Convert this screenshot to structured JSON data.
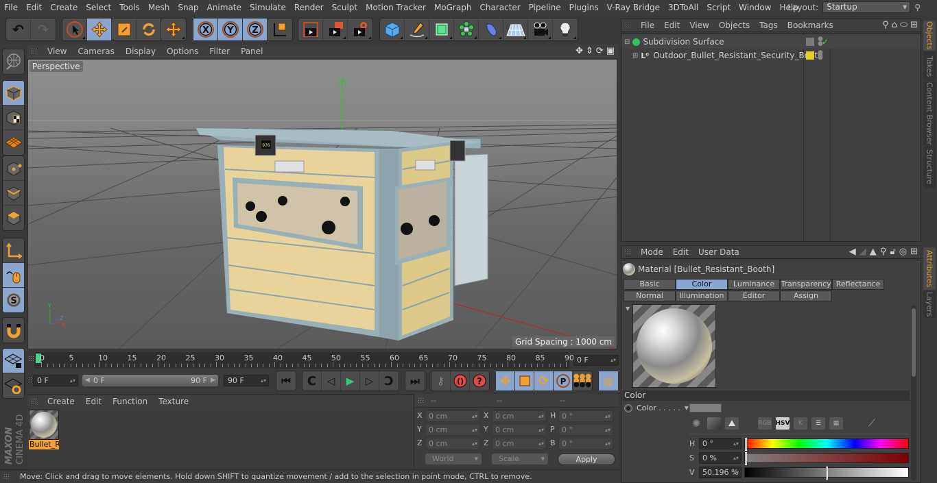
{
  "menubar": {
    "items": [
      "File",
      "Edit",
      "Create",
      "Select",
      "Tools",
      "Mesh",
      "Snap",
      "Animate",
      "Simulate",
      "Render",
      "Sculpt",
      "Motion Tracker",
      "MoGraph",
      "Character",
      "Pipeline",
      "Plugins",
      "V-Ray Bridge",
      "3DToAll",
      "Script",
      "Window",
      "Help"
    ],
    "layout_label": "Layout:",
    "layout_value": "Startup"
  },
  "toolbar": {
    "groups": [
      [
        "undo-icon",
        "redo-icon"
      ],
      [
        "live-selection-icon",
        "move-icon",
        "scale-icon",
        "rotate-icon"
      ],
      [
        "move-recent-icon"
      ],
      [
        "x-axis-lock-icon",
        "y-axis-lock-icon",
        "z-axis-lock-icon",
        "world-coordinates-icon"
      ],
      [
        "render-view-icon",
        "render-to-picture-viewer-icon",
        "render-settings-icon"
      ],
      [
        "cube-icon",
        "pen-icon",
        "subdivision-icon",
        "cloner-icon",
        "deformer-icon",
        "floor-icon",
        "camera-icon",
        "light-icon"
      ]
    ],
    "active": [
      "move-icon",
      "x-axis-lock-icon",
      "y-axis-lock-icon",
      "z-axis-lock-icon"
    ]
  },
  "left_tools": [
    "make-editable-icon",
    "model-mode-icon",
    "texture-mode-icon",
    "workplane-icon",
    "points-mode-icon",
    "edges-mode-icon",
    "polygons-mode-icon",
    "axis-mode-icon",
    "tweak-mode-icon",
    "snap-icon",
    "magnet-icon",
    "lock-workplane-icon",
    "planar-workplane-icon"
  ],
  "viewport": {
    "menu": [
      "View",
      "Cameras",
      "Display",
      "Options",
      "Filter",
      "Panel"
    ],
    "camera_label": "Perspective",
    "grid_spacing": "Grid Spacing : 1000 cm",
    "axis_labels": {
      "y": "Y",
      "z": "Z",
      "x": "X"
    }
  },
  "timeline": {
    "ticks": [
      "0",
      "5",
      "10",
      "15",
      "20",
      "25",
      "30",
      "35",
      "40",
      "45",
      "50",
      "55",
      "60",
      "65",
      "70",
      "75",
      "80",
      "85",
      "90"
    ],
    "current_frame": "0 F",
    "start_field": "0 F",
    "range_start": "0 F",
    "range_end": "90 F",
    "end_field": "90 F"
  },
  "material_manager": {
    "menu": [
      "Create",
      "Edit",
      "Function",
      "Texture"
    ],
    "materials": [
      {
        "label": "Bullet_R",
        "selected": true
      }
    ]
  },
  "coordinates": {
    "headers": [
      "--",
      "--",
      "--"
    ],
    "rows": [
      {
        "l1": "X",
        "v1": "0 cm",
        "l2": "X",
        "v2": "0 cm",
        "l3": "H",
        "v3": "0 °"
      },
      {
        "l1": "Y",
        "v1": "0 cm",
        "l2": "Y",
        "v2": "0 cm",
        "l3": "P",
        "v3": "0 °"
      },
      {
        "l1": "Z",
        "v1": "0 cm",
        "l2": "Z",
        "v2": "0 cm",
        "l3": "B",
        "v3": "0 °"
      }
    ],
    "space": "World",
    "mode": "Scale",
    "apply": "Apply"
  },
  "status": "Move: Click and drag to move elements. Hold down SHIFT to quantize movement / add to the selection in point mode, CTRL to remove.",
  "logo": {
    "brand": "MAXON",
    "product": "CINEMA 4D"
  },
  "object_manager": {
    "menu": [
      "File",
      "Edit",
      "View",
      "Objects",
      "Tags",
      "Bookmarks"
    ],
    "objects": [
      {
        "name": "Subdivision Surface",
        "tag_color": "#7a7a7a",
        "enabled": "✓"
      },
      {
        "name": "Outdoor_Bullet_Resistant_Security_Booth",
        "tag_color": "#e0d020"
      }
    ]
  },
  "right_tabs_top": [
    "Objects",
    "Takes",
    "Content Browser",
    "Structure"
  ],
  "right_tabs_bottom": [
    "Attributes",
    "Layers"
  ],
  "attributes": {
    "menu": [
      "Mode",
      "Edit",
      "User Data"
    ],
    "title": "Material [Bullet_Resistant_Booth]",
    "tabs_row1": [
      "Basic",
      "Color",
      "Luminance",
      "Transparency",
      "Reflectance"
    ],
    "tabs_row2": [
      "Normal",
      "Illumination",
      "Editor",
      "Assign"
    ],
    "active_tab": "Color",
    "section": "Color",
    "color_label": "Color . . . . .",
    "color_swatch": "#808080",
    "color_modes": [
      "wheel",
      "spectrum",
      "picture",
      "RGB",
      "HSV",
      "K",
      "mixer",
      "swatches",
      "eyedropper"
    ],
    "active_mode": "HSV",
    "hsv": [
      {
        "label": "H",
        "value": "0 °",
        "fraction": 0.0
      },
      {
        "label": "S",
        "value": "0 %",
        "fraction": 0.0
      },
      {
        "label": "V",
        "value": "50.196 %",
        "fraction": 0.50196
      }
    ]
  }
}
